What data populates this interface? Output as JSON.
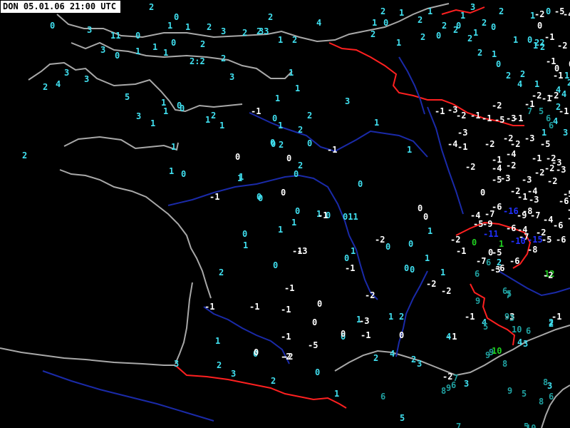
{
  "header": {
    "timestamp": "DON 05.01.06 21:00 UTC"
  },
  "colors": {
    "background": "#000000",
    "coast": "#a8a8a8",
    "border": "#ff2020",
    "river": "#1a2aa8",
    "cold_label": "#ffffff",
    "cool_label": "#40e0f0",
    "mild_label": "#20a0a0",
    "green_label": "#20d020",
    "blue_label": "#2030ff"
  },
  "chart_data": {
    "type": "scatter",
    "title": "DON 05.01.06 21:00 UTC",
    "description_unit": "temperature °C",
    "stations": [
      {
        "v": "0",
        "c": "cool"
      },
      {
        "v": "2",
        "c": "cool"
      },
      {
        "v": "0",
        "c": "cool"
      },
      {
        "v": "1",
        "c": "cool"
      },
      {
        "v": "1",
        "c": "cool"
      },
      {
        "v": "2",
        "c": "cool"
      },
      {
        "v": "3",
        "c": "cool"
      },
      {
        "v": "2",
        "c": "cool"
      },
      {
        "v": "2",
        "c": "cool"
      },
      {
        "v": "2",
        "c": "cool"
      },
      {
        "v": "1",
        "c": "cool"
      },
      {
        "v": "2",
        "c": "cool"
      },
      {
        "v": "0",
        "c": "cool"
      },
      {
        "v": "33",
        "c": "cool"
      },
      {
        "v": "3",
        "c": "cool"
      },
      {
        "v": "11",
        "c": "cool"
      },
      {
        "v": "0",
        "c": "cool"
      },
      {
        "v": "1",
        "c": "cool"
      },
      {
        "v": "1",
        "c": "cool"
      },
      {
        "v": "1",
        "c": "cool"
      },
      {
        "v": "0",
        "c": "cool"
      },
      {
        "v": "2",
        "c": "cool"
      },
      {
        "v": "3",
        "c": "cool"
      },
      {
        "v": "3",
        "c": "cool"
      },
      {
        "v": "4",
        "c": "cool"
      },
      {
        "v": "3",
        "c": "cool"
      },
      {
        "v": "2",
        "c": "cool"
      },
      {
        "v": "2",
        "c": "cool"
      },
      {
        "v": "1",
        "c": "cool"
      },
      {
        "v": "0",
        "c": "cool"
      },
      {
        "v": "1",
        "c": "cool"
      },
      {
        "v": "2",
        "c": "cool"
      },
      {
        "v": "3",
        "c": "cool"
      },
      {
        "v": "-1",
        "c": "cold"
      },
      {
        "v": "0",
        "c": "cool"
      },
      {
        "v": "1",
        "c": "cool"
      },
      {
        "v": "2",
        "c": "cool"
      },
      {
        "v": "2:2",
        "c": "cool"
      },
      {
        "v": "2",
        "c": "cool"
      },
      {
        "v": "1",
        "c": "cool"
      },
      {
        "v": "4",
        "c": "cool"
      },
      {
        "v": "3",
        "c": "cool"
      },
      {
        "v": "1",
        "c": "cool"
      },
      {
        "v": "1",
        "c": "cool"
      },
      {
        "v": "2",
        "c": "cool"
      },
      {
        "v": "3",
        "c": "cool"
      },
      {
        "v": "0",
        "c": "cool"
      },
      {
        "v": "1",
        "c": "cool"
      },
      {
        "v": "1",
        "c": "cool"
      },
      {
        "v": "5",
        "c": "cool"
      },
      {
        "v": "1",
        "c": "cool"
      },
      {
        "v": "0",
        "c": "cool"
      },
      {
        "v": "1",
        "c": "cool"
      },
      {
        "v": "1",
        "c": "cool"
      },
      {
        "v": "0",
        "c": "cool"
      },
      {
        "v": "0",
        "c": "cool"
      },
      {
        "v": "0",
        "c": "cool"
      },
      {
        "v": "1",
        "c": "cool"
      },
      {
        "v": "2",
        "c": "cool"
      },
      {
        "v": "-1",
        "c": "cold"
      },
      {
        "v": "2",
        "c": "cool"
      },
      {
        "v": "1",
        "c": "cool"
      },
      {
        "v": "0",
        "c": "cool"
      },
      {
        "v": "0",
        "c": "cold"
      },
      {
        "v": "0",
        "c": "cold"
      },
      {
        "v": "0",
        "c": "cool"
      },
      {
        "v": "1",
        "c": "cool"
      },
      {
        "v": "0",
        "c": "cool"
      },
      {
        "v": "011",
        "c": "cool"
      },
      {
        "v": "0",
        "c": "cool"
      },
      {
        "v": "1",
        "c": "cool"
      },
      {
        "v": "1",
        "c": "cool"
      },
      {
        "v": "0",
        "c": "cold"
      },
      {
        "v": "0",
        "c": "cold"
      },
      {
        "v": "0",
        "c": "cool"
      },
      {
        "v": "1",
        "c": "cool"
      },
      {
        "v": "1",
        "c": "cool"
      },
      {
        "v": "0",
        "c": "cool"
      },
      {
        "v": "0",
        "c": "cold"
      },
      {
        "v": "1",
        "c": "cool"
      },
      {
        "v": "-1",
        "c": "cold"
      },
      {
        "v": "0",
        "c": "cool"
      },
      {
        "v": "0",
        "c": "cool"
      },
      {
        "v": "1",
        "c": "cool"
      },
      {
        "v": "-2",
        "c": "cold"
      },
      {
        "v": "-1",
        "c": "cold"
      },
      {
        "v": "0",
        "c": "cool"
      },
      {
        "v": "-1",
        "c": "cold"
      },
      {
        "v": "-1",
        "c": "cold"
      },
      {
        "v": "-1",
        "c": "cold"
      },
      {
        "v": "2",
        "c": "cool"
      },
      {
        "v": "-1",
        "c": "cold"
      },
      {
        "v": "0",
        "c": "cold"
      },
      {
        "v": "-1",
        "c": "cold"
      },
      {
        "v": "-2",
        "c": "cold"
      },
      {
        "v": "0",
        "c": "cold"
      },
      {
        "v": "-1",
        "c": "cold"
      },
      {
        "v": "1",
        "c": "cool"
      },
      {
        "v": "0",
        "c": "cool"
      },
      {
        "v": "2",
        "c": "cool"
      },
      {
        "v": "1",
        "c": "cool"
      },
      {
        "v": "-3",
        "c": "cold"
      },
      {
        "v": "0",
        "c": "cool"
      },
      {
        "v": "1",
        "c": "cool"
      },
      {
        "v": "0",
        "c": "cool"
      },
      {
        "v": "-2",
        "c": "cold"
      },
      {
        "v": "-2",
        "c": "cold"
      },
      {
        "v": "-1",
        "c": "cold"
      },
      {
        "v": "-1",
        "c": "cold"
      },
      {
        "v": "-3",
        "c": "cold"
      },
      {
        "v": "0",
        "c": "cool"
      },
      {
        "v": "1",
        "c": "cool"
      },
      {
        "v": "1",
        "c": "cool"
      },
      {
        "v": "-3",
        "c": "cold"
      },
      {
        "v": "0",
        "c": "cool"
      },
      {
        "v": "0",
        "c": "cold"
      },
      {
        "v": "-1",
        "c": "cold"
      },
      {
        "v": "-1",
        "c": "cold"
      },
      {
        "v": "-2",
        "c": "cold"
      },
      {
        "v": "0",
        "c": "cold"
      },
      {
        "v": "0",
        "c": "cool"
      },
      {
        "v": "1",
        "c": "cool"
      },
      {
        "v": "-2",
        "c": "cold"
      },
      {
        "v": "2",
        "c": "cool"
      },
      {
        "v": "0",
        "c": "cold"
      },
      {
        "v": "-5",
        "c": "cold"
      },
      {
        "v": "3",
        "c": "cool"
      },
      {
        "v": "2",
        "c": "cool"
      },
      {
        "v": "0",
        "c": "cool"
      },
      {
        "v": "1",
        "c": "cool"
      },
      {
        "v": "2",
        "c": "cool"
      },
      {
        "v": "4",
        "c": "cool"
      },
      {
        "v": "4",
        "c": "cool"
      },
      {
        "v": "4",
        "c": "cool"
      },
      {
        "v": "3",
        "c": "cool"
      },
      {
        "v": "2",
        "c": "cool"
      },
      {
        "v": "3",
        "c": "cool"
      },
      {
        "v": "4",
        "c": "cool"
      },
      {
        "v": "3",
        "c": "cool"
      },
      {
        "v": "3",
        "c": "cool"
      },
      {
        "v": "2",
        "c": "cool"
      },
      {
        "v": "3",
        "c": "cool"
      },
      {
        "v": "-2",
        "c": "cold"
      },
      {
        "v": "6",
        "c": "mild"
      },
      {
        "v": "5",
        "c": "cool"
      },
      {
        "v": "7",
        "c": "mild"
      },
      {
        "v": "6",
        "c": "mild"
      },
      {
        "v": "8",
        "c": "mild"
      },
      {
        "v": "9",
        "c": "mild"
      },
      {
        "v": "8",
        "c": "mild"
      },
      {
        "v": "8",
        "c": "mild"
      },
      {
        "v": "5",
        "c": "mild"
      },
      {
        "v": "6",
        "c": "mild"
      },
      {
        "v": "7",
        "c": "mild"
      },
      {
        "v": "5",
        "c": "mild"
      },
      {
        "v": "9",
        "c": "mild"
      },
      {
        "v": "8",
        "c": "mild"
      },
      {
        "v": "9",
        "c": "mild"
      },
      {
        "v": "10",
        "c": "green"
      },
      {
        "v": "12",
        "c": "green"
      },
      {
        "v": "9",
        "c": "mild"
      },
      {
        "v": "10",
        "c": "mild"
      },
      {
        "v": "6",
        "c": "mild"
      },
      {
        "v": "5",
        "c": "mild"
      },
      {
        "v": "9",
        "c": "mild"
      },
      {
        "v": "10",
        "c": "mild"
      },
      {
        "v": "9",
        "c": "mild"
      },
      {
        "v": "6",
        "c": "mild"
      },
      {
        "v": "7",
        "c": "mild"
      },
      {
        "v": "3",
        "c": "mild"
      },
      {
        "v": "6",
        "c": "mild"
      },
      {
        "v": "5",
        "c": "mild"
      },
      {
        "v": "-1",
        "c": "cold"
      },
      {
        "v": "2",
        "c": "cool"
      },
      {
        "v": "-2",
        "c": "cold"
      },
      {
        "v": "-2",
        "c": "cold"
      },
      {
        "v": "-1",
        "c": "cold"
      },
      {
        "v": "-6",
        "c": "cold"
      },
      {
        "v": "0",
        "c": "green"
      },
      {
        "v": "1",
        "c": "green"
      },
      {
        "v": "-5",
        "c": "cold"
      },
      {
        "v": "-5",
        "c": "cold"
      },
      {
        "v": "0",
        "c": "cold"
      },
      {
        "v": "6",
        "c": "mild"
      },
      {
        "v": "2",
        "c": "cool"
      },
      {
        "v": "-6",
        "c": "cold"
      },
      {
        "v": "-7",
        "c": "cold"
      },
      {
        "v": "-3",
        "c": "cold"
      },
      {
        "v": "-6",
        "c": "cold"
      },
      {
        "v": "-8",
        "c": "cold"
      },
      {
        "v": "-6",
        "c": "cold"
      },
      {
        "v": "-7",
        "c": "cold"
      },
      {
        "v": "-10",
        "c": "blue"
      },
      {
        "v": "-15",
        "c": "blue"
      },
      {
        "v": "-11",
        "c": "blue"
      },
      {
        "v": "-9",
        "c": "cold"
      },
      {
        "v": "-4",
        "c": "cold"
      },
      {
        "v": "-7",
        "c": "cold"
      },
      {
        "v": "-6",
        "c": "cold"
      },
      {
        "v": "-4",
        "c": "cold"
      },
      {
        "v": "-2",
        "c": "cold"
      },
      {
        "v": "-5",
        "c": "cold"
      },
      {
        "v": "-4",
        "c": "cold"
      },
      {
        "v": "-3",
        "c": "cold"
      },
      {
        "v": "-6",
        "c": "cold"
      },
      {
        "v": "-9",
        "c": "cold"
      },
      {
        "v": "-8",
        "c": "cold"
      },
      {
        "v": "-7",
        "c": "cold"
      },
      {
        "v": "-16",
        "c": "blue"
      },
      {
        "v": "-4",
        "c": "cold"
      },
      {
        "v": "-5",
        "c": "cold"
      },
      {
        "v": "-2",
        "c": "cold"
      },
      {
        "v": "-3",
        "c": "cold"
      },
      {
        "v": "-4",
        "c": "cold"
      },
      {
        "v": "-2",
        "c": "cold"
      },
      {
        "v": "-6",
        "c": "cold"
      },
      {
        "v": "-5",
        "c": "cold"
      },
      {
        "v": "-3",
        "c": "cold"
      },
      {
        "v": "-2",
        "c": "cold"
      },
      {
        "v": "-1",
        "c": "cold"
      },
      {
        "v": "-3",
        "c": "cold"
      },
      {
        "v": "-2",
        "c": "cold"
      },
      {
        "v": "-1",
        "c": "cold"
      },
      {
        "v": "-2",
        "c": "cold"
      },
      {
        "v": "-3",
        "c": "cold"
      },
      {
        "v": "-4",
        "c": "cold"
      },
      {
        "v": "-2",
        "c": "cold"
      },
      {
        "v": "-2",
        "c": "cold"
      },
      {
        "v": "-3",
        "c": "cold"
      },
      {
        "v": "-5",
        "c": "cold"
      },
      {
        "v": "-3",
        "c": "cold"
      },
      {
        "v": "-4",
        "c": "cold"
      },
      {
        "v": "-1",
        "c": "cold"
      },
      {
        "v": "-2",
        "c": "cold"
      },
      {
        "v": "0",
        "c": "cold"
      },
      {
        "v": "-1",
        "c": "cold"
      },
      {
        "v": "-4",
        "c": "cold"
      },
      {
        "v": "-2",
        "c": "cold"
      },
      {
        "v": "-2",
        "c": "cold"
      },
      {
        "v": "-3",
        "c": "cold"
      },
      {
        "v": "-1",
        "c": "cold"
      },
      {
        "v": "-3",
        "c": "cold"
      },
      {
        "v": "-2",
        "c": "cold"
      },
      {
        "v": "-1",
        "c": "cold"
      },
      {
        "v": "-1",
        "c": "cold"
      },
      {
        "v": "-5",
        "c": "cold"
      },
      {
        "v": "-3",
        "c": "cold"
      },
      {
        "v": "-1",
        "c": "cold"
      },
      {
        "v": "-2",
        "c": "cold"
      },
      {
        "v": "-1",
        "c": "cold"
      },
      {
        "v": "-4",
        "c": "cold"
      },
      {
        "v": "-5",
        "c": "cold"
      },
      {
        "v": "-2",
        "c": "cold"
      },
      {
        "v": "0",
        "c": "cold"
      },
      {
        "v": "-1",
        "c": "cold"
      },
      {
        "v": "-2",
        "c": "cold"
      },
      {
        "v": "-1",
        "c": "cold"
      },
      {
        "v": "0",
        "c": "cold"
      },
      {
        "v": "1",
        "c": "cool"
      },
      {
        "v": "2",
        "c": "cool"
      },
      {
        "v": "0",
        "c": "cool"
      },
      {
        "v": "2",
        "c": "cool"
      },
      {
        "v": "1",
        "c": "cool"
      },
      {
        "v": "2",
        "c": "cool"
      },
      {
        "v": "0",
        "c": "cool"
      },
      {
        "v": "1",
        "c": "cool"
      },
      {
        "v": "0",
        "c": "cool"
      },
      {
        "v": "22",
        "c": "cool"
      },
      {
        "v": "1",
        "c": "cool"
      },
      {
        "v": "0",
        "c": "cool"
      },
      {
        "v": "2",
        "c": "cool"
      },
      {
        "v": "1",
        "c": "cool"
      },
      {
        "v": "0",
        "c": "cool"
      },
      {
        "v": "2",
        "c": "cool"
      },
      {
        "v": "1",
        "c": "cool"
      },
      {
        "v": "1",
        "c": "cool"
      },
      {
        "v": "0",
        "c": "cool"
      },
      {
        "v": "2",
        "c": "cool"
      },
      {
        "v": "1",
        "c": "cool"
      },
      {
        "v": "2",
        "c": "cool"
      },
      {
        "v": "2",
        "c": "cool"
      },
      {
        "v": "1",
        "c": "cool"
      },
      {
        "v": "2",
        "c": "cool"
      },
      {
        "v": "2",
        "c": "cool"
      },
      {
        "v": "1",
        "c": "cool"
      },
      {
        "v": "0",
        "c": "cool"
      },
      {
        "v": "3",
        "c": "cool"
      },
      {
        "v": "2",
        "c": "cool"
      },
      {
        "v": "2",
        "c": "cool"
      },
      {
        "v": "4",
        "c": "cool"
      },
      {
        "v": "2",
        "c": "cool"
      },
      {
        "v": "1",
        "c": "cool"
      },
      {
        "v": "-1",
        "c": "cold"
      },
      {
        "v": "-2",
        "c": "cold"
      },
      {
        "v": "4",
        "c": "cool"
      },
      {
        "v": "5",
        "c": "mild"
      },
      {
        "v": "7",
        "c": "mild"
      },
      {
        "v": "6",
        "c": "mild"
      },
      {
        "v": "6",
        "c": "mild"
      },
      {
        "v": "3",
        "c": "cool"
      },
      {
        "v": "4",
        "c": "cool"
      },
      {
        "v": "2",
        "c": "cool"
      },
      {
        "v": "4",
        "c": "cool"
      },
      {
        "v": "2",
        "c": "cool"
      },
      {
        "v": "0",
        "c": "cold"
      },
      {
        "v": "-1",
        "c": "cold"
      },
      {
        "v": "1",
        "c": "cool"
      },
      {
        "v": "1",
        "c": "cool"
      },
      {
        "v": "-2",
        "c": "cold"
      },
      {
        "v": "-1",
        "c": "cold"
      }
    ]
  }
}
